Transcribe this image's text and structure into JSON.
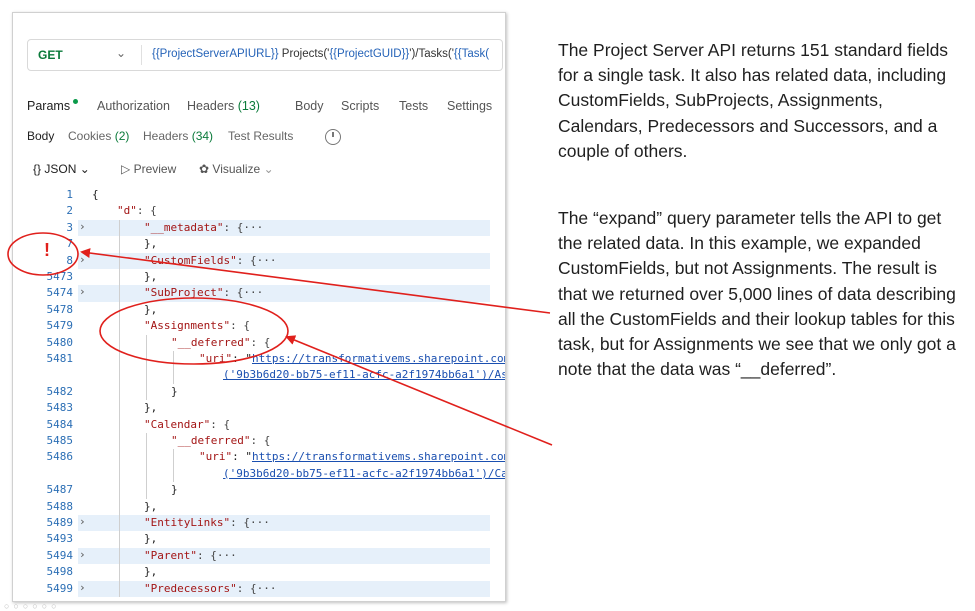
{
  "request": {
    "method": "GET",
    "url_segments": [
      {
        "text": "{{ProjectServerAPIURL}}",
        "var": true
      },
      {
        "text": " Projects('",
        "var": false
      },
      {
        "text": "{{ProjectGUID}}",
        "var": true
      },
      {
        "text": "')/Tasks('",
        "var": false
      },
      {
        "text": "{{Task(",
        "var": true
      }
    ]
  },
  "request_tabs": {
    "params": "Params",
    "authorization": "Authorization",
    "headers": "Headers",
    "headers_count": "(13)",
    "body": "Body",
    "scripts": "Scripts",
    "tests": "Tests",
    "settings": "Settings"
  },
  "response_tabs": {
    "body": "Body",
    "cookies": "Cookies",
    "cookies_count": "(2)",
    "headers": "Headers",
    "headers_count": "(34)",
    "test_results": "Test Results"
  },
  "toolbar": {
    "format": "{} JSON",
    "preview": "Preview",
    "visualize": "Visualize"
  },
  "code_lines": [
    {
      "n": "1",
      "t": "{"
    },
    {
      "n": "2",
      "t": "\"d\": {"
    },
    {
      "n": "3",
      "t": "\"__metadata\": {···"
    },
    {
      "n": "7",
      "t": "},"
    },
    {
      "n": "8",
      "t": "\"CustomFields\": {···"
    },
    {
      "n": "5473",
      "t": "},"
    },
    {
      "n": "5474",
      "t": "\"SubProject\": {···"
    },
    {
      "n": "5478",
      "t": "},"
    },
    {
      "n": "5479",
      "t": "\"Assignments\": {"
    },
    {
      "n": "5480",
      "t": "\"__deferred\": {"
    },
    {
      "n": "5481",
      "t": "\"uri\": \"https://transformativems.sharepoint.com"
    },
    {
      "n": "",
      "t": "('9b3b6d20-bb75-ef11-acfc-a2f1974bb6a1')/As"
    },
    {
      "n": "5482",
      "t": "}"
    },
    {
      "n": "5483",
      "t": "},"
    },
    {
      "n": "5484",
      "t": "\"Calendar\": {"
    },
    {
      "n": "5485",
      "t": "\"__deferred\": {"
    },
    {
      "n": "5486",
      "t": "\"uri\": \"https://transformativems.sharepoint.com"
    },
    {
      "n": "",
      "t": "('9b3b6d20-bb75-ef11-acfc-a2f1974bb6a1')/Ca"
    },
    {
      "n": "5487",
      "t": "}"
    },
    {
      "n": "5488",
      "t": "},"
    },
    {
      "n": "5489",
      "t": "\"EntityLinks\": {···"
    },
    {
      "n": "5493",
      "t": "},"
    },
    {
      "n": "5494",
      "t": "\"Parent\": {···"
    },
    {
      "n": "5498",
      "t": "},"
    },
    {
      "n": "5499",
      "t": "\"Predecessors\": {···"
    }
  ],
  "annotation_mark": "!",
  "explanation": {
    "p1": "The Project Server API returns 151 standard fields for a single task. It also has related data, including CustomFields, SubProjects, Assignments, Calendars, Predecessors and Successors, and a couple of others.",
    "p2": "The “expand” query parameter tells the API to get the related data. In this example, we expanded CustomFields, but not Assignments. The result is that we returned over 5,000 lines of data describing all the CustomFields and their lookup tables for this task, but for Assignments we see that we only got a note that the data was “__deferred”."
  },
  "colors": {
    "annotation": "#e0201c",
    "link": "#1a4fb0",
    "line_number": "#2c6fb5",
    "highlight_row": "#e6f0fa",
    "method_get": "#0a7a3a"
  }
}
